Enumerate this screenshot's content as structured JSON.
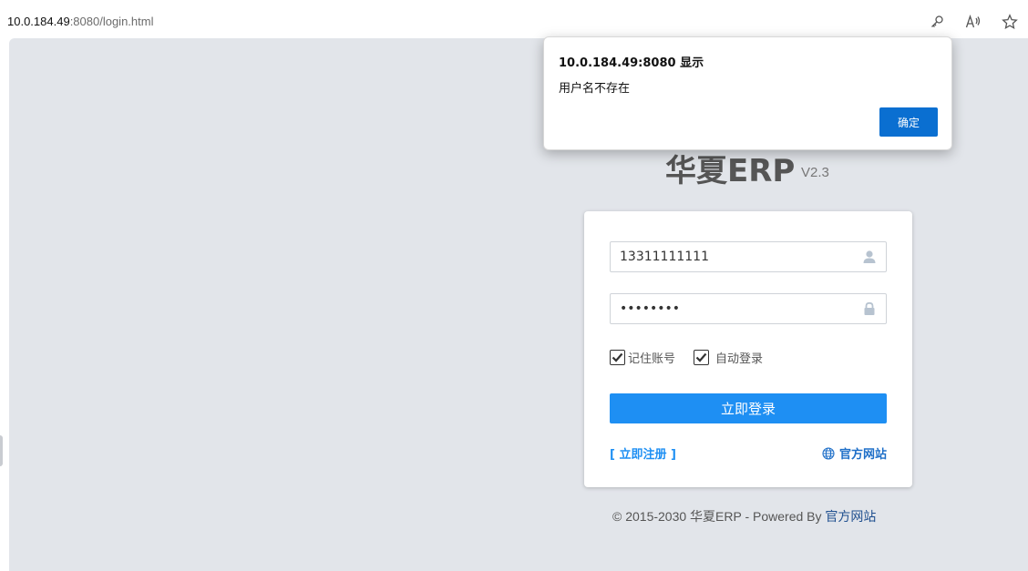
{
  "browser": {
    "url_host": "10.0.184.49",
    "url_rest": ":8080/login.html"
  },
  "icons": {
    "key": "key-icon",
    "read_aloud": "read-aloud-icon",
    "favorite": "star-icon",
    "user": "user-icon",
    "lock": "lock-icon",
    "globe": "globe-icon",
    "check": "check-icon"
  },
  "colors": {
    "primary": "#1e8ff3",
    "dialog_button": "#0a6fd1",
    "page_background": "#e2e5ea"
  },
  "dialog": {
    "title": "10.0.184.49:8080 显示",
    "message": "用户名不存在",
    "ok_label": "确定"
  },
  "login": {
    "app_title": "华夏ERP",
    "version": "V2.3",
    "username_value": "13311111111",
    "password_value": "12345678",
    "remember_label": "记住账号",
    "remember_checked": true,
    "auto_login_label": "自动登录",
    "auto_login_checked": true,
    "submit_label": "立即登录",
    "register_label": "[ 立即注册 ]",
    "official_site_label": "官方网站"
  },
  "footer": {
    "copyright": "© 2015-2030 华夏ERP - Powered By ",
    "link_label": "官方网站"
  }
}
